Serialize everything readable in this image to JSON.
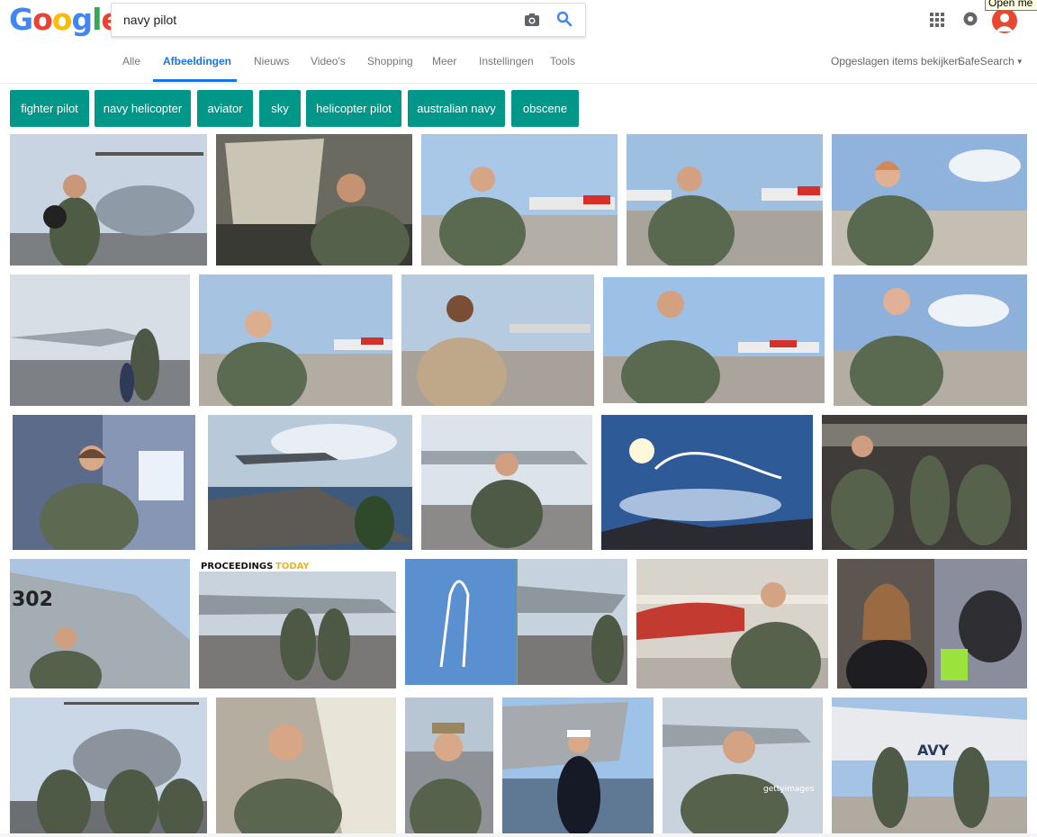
{
  "logo": {
    "letters": [
      "G",
      "o",
      "o",
      "g",
      "l",
      "e"
    ],
    "colors": [
      "#4285F4",
      "#EA4335",
      "#FBBC05",
      "#4285F4",
      "#34A853",
      "#EA4335"
    ]
  },
  "search": {
    "query": "navy pilot"
  },
  "tooltip": {
    "text": "Open me"
  },
  "nav": {
    "tabs": [
      "Alle",
      "Afbeeldingen",
      "Nieuws",
      "Video's",
      "Shopping",
      "Meer",
      "Instellingen",
      "Tools"
    ],
    "active_tab": "Afbeeldingen",
    "saved_items": "Opgeslagen items bekijken",
    "safesearch": "SafeSearch"
  },
  "chips": [
    "fighter pilot",
    "navy helicopter",
    "aviator",
    "sky",
    "helicopter pilot",
    "australian navy",
    "obscene"
  ],
  "overlay_texts": {
    "proceedings": "PROCEEDINGS",
    "today": "TODAY",
    "number": "302",
    "navy": "AVY",
    "getty": "gettyimages"
  },
  "colors": {
    "accent": "#1a73e8",
    "chip": "#009688",
    "avatar": "#e8482f"
  }
}
